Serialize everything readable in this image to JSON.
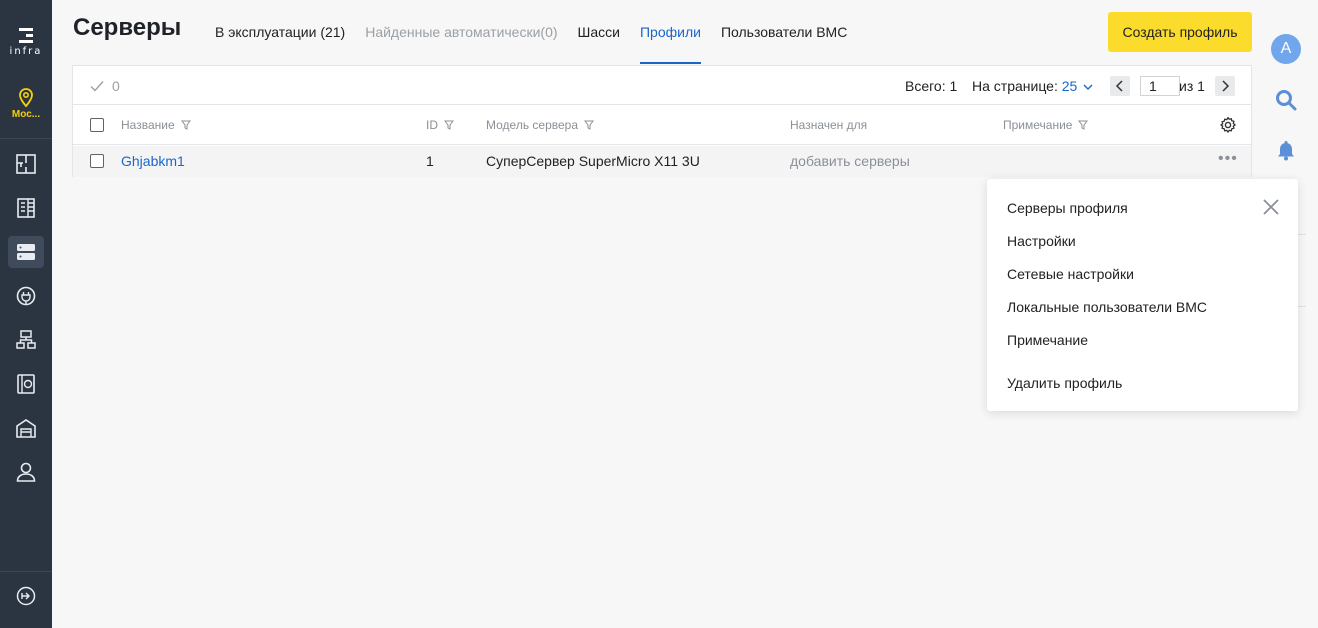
{
  "sidebar": {
    "logo_text": "infra",
    "location_label": "Мос...",
    "nav_items": [
      {
        "name": "nav-floorplan-icon"
      },
      {
        "name": "nav-racks-icon"
      },
      {
        "name": "nav-servers-icon",
        "active": true
      },
      {
        "name": "nav-power-icon"
      },
      {
        "name": "nav-network-icon"
      },
      {
        "name": "nav-storage-icon"
      },
      {
        "name": "nav-warehouse-icon"
      },
      {
        "name": "nav-users-icon"
      }
    ],
    "bottom_item": "nav-expand-icon"
  },
  "header": {
    "title": "Серверы",
    "tabs": [
      {
        "label": "В эксплуатации (21)"
      },
      {
        "label": "Найденные автоматически(0)",
        "disabled": true
      },
      {
        "label": "Шасси"
      },
      {
        "label": "Профили",
        "active": true
      },
      {
        "label": "Пользователи BMC"
      }
    ],
    "create_button": "Создать профиль"
  },
  "user": {
    "avatar_letter": "A"
  },
  "toolbar": {
    "selected_count": "0",
    "total_label": "Всего: 1",
    "per_page_label": "На странице:",
    "per_page_value": "25",
    "page_value": "1",
    "page_of": "из 1"
  },
  "table": {
    "columns": [
      "Название",
      "ID",
      "Модель сервера",
      "Назначен для",
      "Примечание"
    ],
    "rows": [
      {
        "name": "Ghjabkm1",
        "id": "1",
        "model": "СуперСервер SuperMicro X11 3U",
        "assigned": "добавить серверы",
        "note": ""
      }
    ]
  },
  "context_menu": {
    "items": [
      "Серверы профиля",
      "Настройки",
      "Сетевые настройки",
      "Локальные пользователи BMC",
      "Примечание",
      "Удалить профиль"
    ]
  },
  "colors": {
    "sidebar_bg": "#2b3542",
    "accent_blue": "#1a66c9",
    "primary_button": "#fbdc2c",
    "location_yellow": "#f5d10a"
  }
}
